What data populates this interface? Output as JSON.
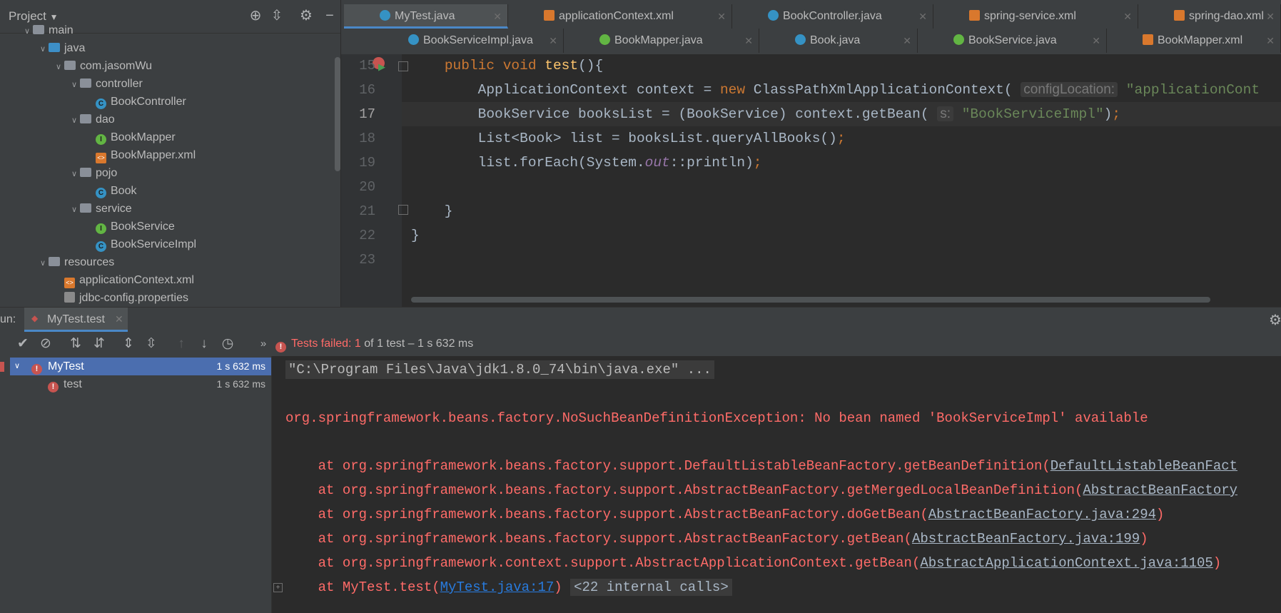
{
  "project": {
    "title": "Project",
    "tree": [
      {
        "label": "main",
        "type": "folder",
        "depth": 0,
        "expanded": true
      },
      {
        "label": "java",
        "type": "folder-blue",
        "depth": 1,
        "expanded": true
      },
      {
        "label": "com.jasomWu",
        "type": "package",
        "depth": 2,
        "expanded": true
      },
      {
        "label": "controller",
        "type": "package",
        "depth": 3,
        "expanded": true
      },
      {
        "label": "BookController",
        "type": "class",
        "depth": 4
      },
      {
        "label": "dao",
        "type": "package",
        "depth": 3,
        "expanded": true
      },
      {
        "label": "BookMapper",
        "type": "interface",
        "depth": 4
      },
      {
        "label": "BookMapper.xml",
        "type": "xml",
        "depth": 4
      },
      {
        "label": "pojo",
        "type": "package",
        "depth": 3,
        "expanded": true
      },
      {
        "label": "Book",
        "type": "class",
        "depth": 4
      },
      {
        "label": "service",
        "type": "package",
        "depth": 3,
        "expanded": true
      },
      {
        "label": "BookService",
        "type": "interface",
        "depth": 4
      },
      {
        "label": "BookServiceImpl",
        "type": "class",
        "depth": 4
      },
      {
        "label": "resources",
        "type": "folder",
        "depth": 1,
        "expanded": true
      },
      {
        "label": "applicationContext.xml",
        "type": "xml",
        "depth": 2
      },
      {
        "label": "jdbc-config.properties",
        "type": "props",
        "depth": 2
      }
    ]
  },
  "tabs_row1": [
    {
      "label": "MyTest.java",
      "icon": "class",
      "active": true
    },
    {
      "label": "applicationContext.xml",
      "icon": "xml"
    },
    {
      "label": "BookController.java",
      "icon": "class"
    },
    {
      "label": "spring-service.xml",
      "icon": "xml"
    },
    {
      "label": "spring-dao.xml",
      "icon": "xml"
    }
  ],
  "tabs_row2": [
    {
      "label": "BookServiceImpl.java",
      "icon": "class"
    },
    {
      "label": "BookMapper.java",
      "icon": "interface"
    },
    {
      "label": "Book.java",
      "icon": "class"
    },
    {
      "label": "BookService.java",
      "icon": "interface"
    },
    {
      "label": "BookMapper.xml",
      "icon": "xml"
    }
  ],
  "editor": {
    "line_numbers": [
      "15",
      "16",
      "17",
      "18",
      "19",
      "20",
      "21",
      "22",
      "23"
    ],
    "current_line": "17",
    "hint_config": "configLocation:",
    "hint_s": "s:",
    "str_appctx": "\"applicationCont",
    "str_impl": "\"BookServiceImpl\""
  },
  "run": {
    "label": "un:",
    "tab": "MyTest.test",
    "status_failed": "Tests failed: 1",
    "status_rest": " of 1 test – 1 s 632 ms",
    "tree": [
      {
        "name": "MyTest",
        "duration": "1 s 632 ms"
      },
      {
        "name": "test",
        "duration": "1 s 632 ms"
      }
    ],
    "console": {
      "cmd": "\"C:\\Program Files\\Java\\jdk1.8.0_74\\bin\\java.exe\" ...",
      "exception": "org.springframework.beans.factory.NoSuchBeanDefinitionException: No bean named 'BookServiceImpl' available",
      "stack": [
        {
          "text": "    at org.springframework.beans.factory.support.DefaultListableBeanFactory.getBeanDefinition(",
          "link": "DefaultListableBeanFact",
          "tail": ""
        },
        {
          "text": "    at org.springframework.beans.factory.support.AbstractBeanFactory.getMergedLocalBeanDefinition(",
          "link": "AbstractBeanFactory",
          "tail": ""
        },
        {
          "text": "    at org.springframework.beans.factory.support.AbstractBeanFactory.doGetBean(",
          "link": "AbstractBeanFactory.java:294",
          "tail": ")"
        },
        {
          "text": "    at org.springframework.beans.factory.support.AbstractBeanFactory.getBean(",
          "link": "AbstractBeanFactory.java:199",
          "tail": ")"
        },
        {
          "text": "    at org.springframework.context.support.AbstractApplicationContext.getBean(",
          "link": "AbstractApplicationContext.java:1105",
          "tail": ")"
        }
      ],
      "last_prefix": "    at MyTest.test(",
      "last_link": "MyTest.java:17",
      "last_tail": ")",
      "internal": "<22 internal calls>"
    }
  },
  "colors": {
    "accent": "#4a88c7",
    "error": "#ff6b68",
    "selection": "#4b6eaf"
  }
}
